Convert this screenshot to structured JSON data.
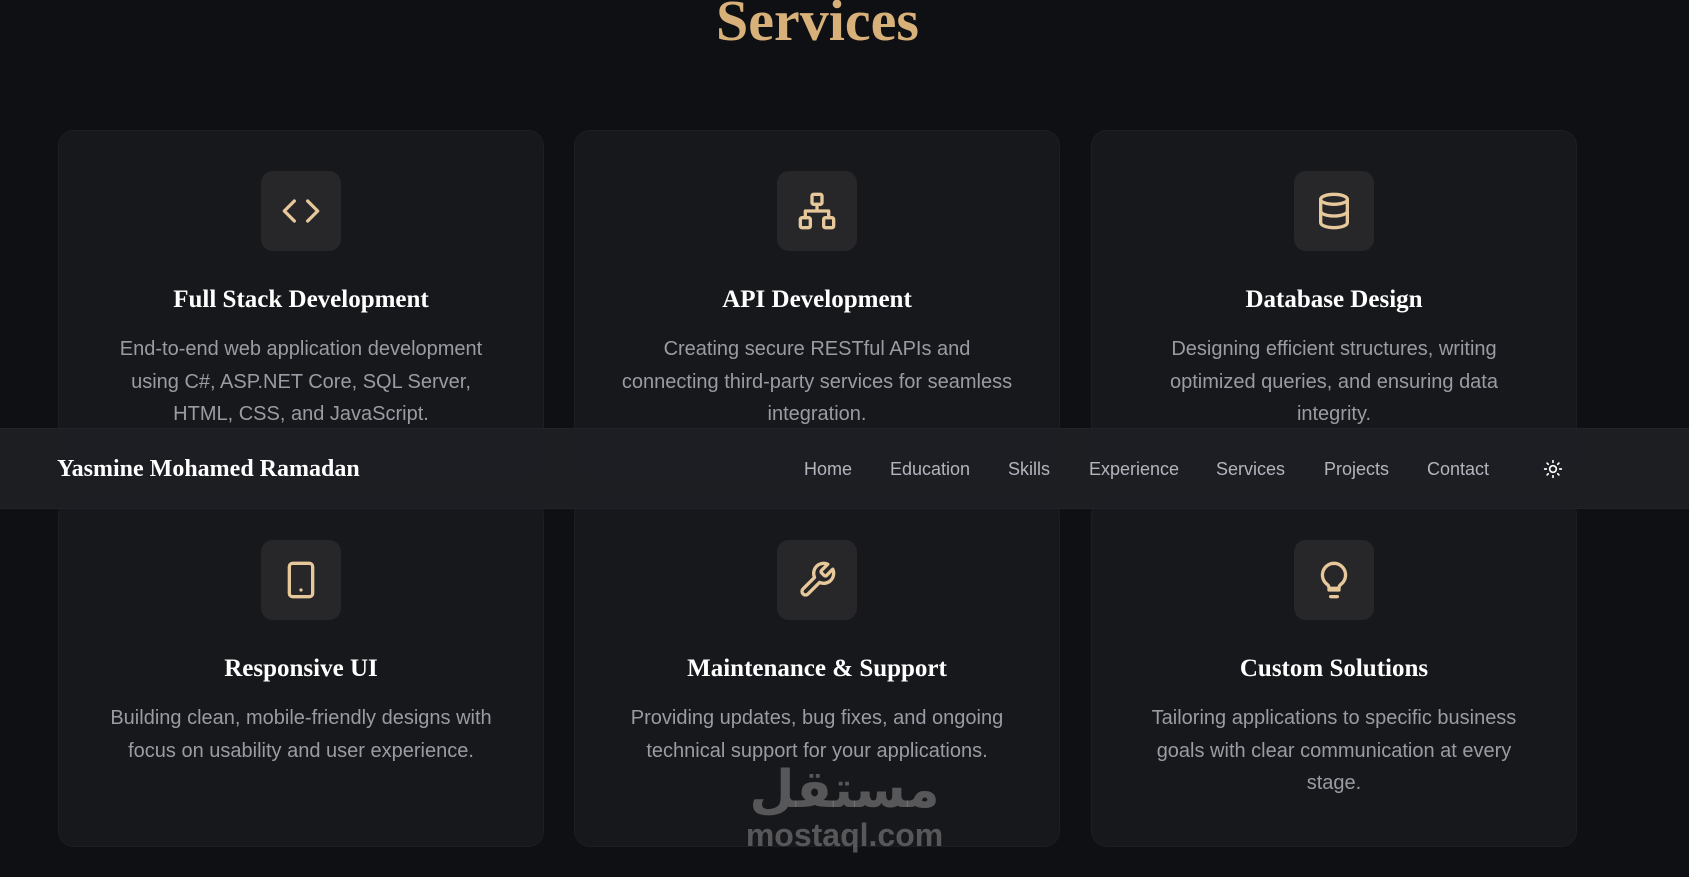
{
  "section": {
    "title": "Services"
  },
  "colors": {
    "accent": "#d8b07a",
    "background": "#0f1014",
    "card": "#17181c",
    "icon_box": "#27272a"
  },
  "services": [
    {
      "icon": "code-icon",
      "title": "Full Stack Development",
      "description": "End-to-end web application development using C#, ASP.NET Core, SQL Server, HTML, CSS, and JavaScript."
    },
    {
      "icon": "sitemap-icon",
      "title": "API Development",
      "description": "Creating secure RESTful APIs and connecting third-party services for seamless integration."
    },
    {
      "icon": "database-icon",
      "title": "Database Design",
      "description": "Designing efficient structures, writing optimized queries, and ensuring data integrity."
    },
    {
      "icon": "tablet-icon",
      "title": "Responsive UI",
      "description": "Building clean, mobile-friendly designs with focus on usability and user experience."
    },
    {
      "icon": "wrench-icon",
      "title": "Maintenance & Support",
      "description": "Providing updates, bug fixes, and ongoing technical support for your applications."
    },
    {
      "icon": "lightbulb-icon",
      "title": "Custom Solutions",
      "description": "Tailoring applications to specific business goals with clear communication at every stage."
    }
  ],
  "navbar": {
    "brand": "Yasmine Mohamed Ramadan",
    "links": [
      "Home",
      "Education",
      "Skills",
      "Experience",
      "Services",
      "Projects",
      "Contact"
    ],
    "theme_toggle_icon": "sun-icon"
  },
  "watermark": {
    "arabic": "مستقل",
    "latin": "mostaql.com"
  }
}
